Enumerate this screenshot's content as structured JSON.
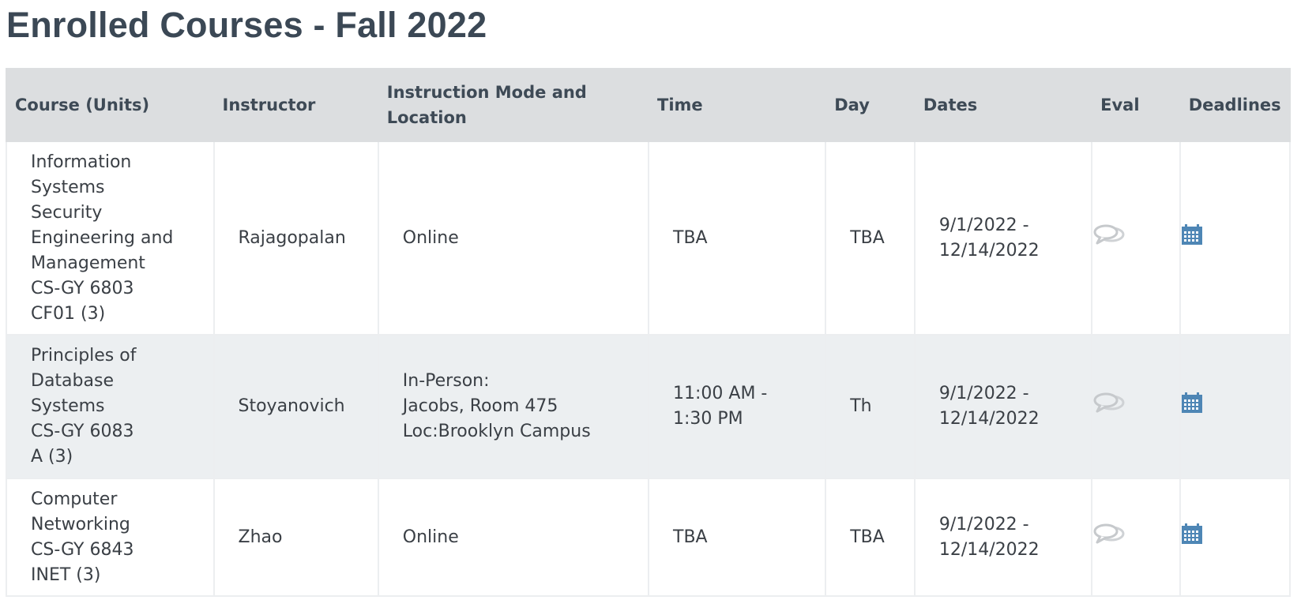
{
  "page": {
    "title": "Enrolled Courses - Fall 2022"
  },
  "table": {
    "headers": {
      "course": "Course (Units)",
      "instructor": "Instructor",
      "mode": "Instruction Mode and\nLocation",
      "time": "Time",
      "day": "Day",
      "dates": "Dates",
      "eval": "Eval",
      "deadlines": "Deadlines"
    },
    "rows": [
      {
        "course": "Information\nSystems\nSecurity\nEngineering and\nManagement\nCS-GY 6803\n CF01 (3)",
        "instructor": "Rajagopalan",
        "mode": "Online",
        "time": "TBA",
        "day": "TBA",
        "dates": "9/1/2022 -\n12/14/2022",
        "eval_icon": "speech-bubbles-icon",
        "deadlines_icon": "calendar-icon"
      },
      {
        "course": "Principles of\nDatabase\nSystems\nCS-GY 6083\n A (3)",
        "instructor": "Stoyanovich",
        "mode": "In-Person:\nJacobs, Room 475\nLoc:Brooklyn Campus",
        "time": "11:00 AM -\n1:30 PM",
        "day": "Th",
        "dates": "9/1/2022 -\n12/14/2022",
        "eval_icon": "speech-bubbles-icon",
        "deadlines_icon": "calendar-icon"
      },
      {
        "course": "Computer\nNetworking\nCS-GY 6843\n INET (3)",
        "instructor": "Zhao",
        "mode": "Online",
        "time": "TBA",
        "day": "TBA",
        "dates": "9/1/2022 -\n12/14/2022",
        "eval_icon": "speech-bubbles-icon",
        "deadlines_icon": "calendar-icon"
      }
    ]
  },
  "colors": {
    "title": "#3b4855",
    "header_bg": "#dcdee0",
    "row_alt_bg": "#eceff1",
    "calendar_icon": "#4e86b5",
    "eval_icon": "#c8cbce"
  }
}
